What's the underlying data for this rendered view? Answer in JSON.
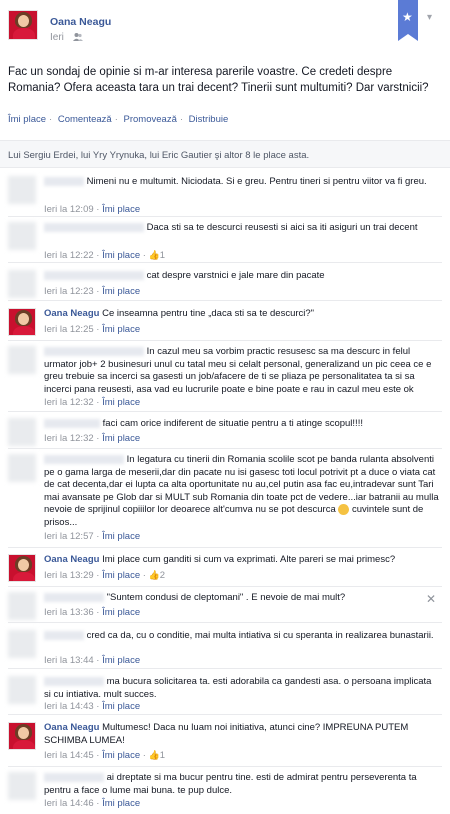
{
  "post": {
    "author": "Oana Neagu",
    "time": "Ieri",
    "text": "Fac un sondaj de opinie si m-ar interesa parerile voastre. Ce credeti despre Romania? Ofera aceasta tara un trai decent? Tinerii sunt multumiti? Dar varstnicii?",
    "actions": [
      "Îmi place",
      "Comentează",
      "Promovează",
      "Distribuie"
    ],
    "likes_text": "Lui Sergiu Erdei, lui Yry Yrynuka, lui Eric Gautier şi altor 8 le place asta."
  },
  "icons": {
    "star": "star-icon",
    "chevron": "chevron-down-icon",
    "people": "people-icon",
    "thumb": "thumbs-up-icon",
    "smiley": "smiley-icon",
    "close": "close-icon"
  },
  "colors": {
    "link": "#3b5998",
    "flag": "#5b7bd5",
    "muted": "#90949c"
  },
  "comments": [
    {
      "text": "Nimeni nu e multumit. Niciodata. Si e greu. Pentru tineri si pentru viitor va fi greu.",
      "time": "Ieri la 12:09",
      "like": "Îmi place",
      "count": ""
    },
    {
      "text": "Daca sti sa te descurci reusesti si aici sa iti asiguri un trai decent",
      "time": "Ieri la 12:22",
      "like": "Îmi place",
      "count": "1"
    },
    {
      "text": "cat despre varstnici e jale mare din pacate",
      "time": "Ieri la 12:23",
      "like": "Îmi place",
      "count": ""
    },
    {
      "author": "Oana Neagu",
      "text": "Ce inseamna pentru tine „daca sti sa te descurci?\"",
      "time": "Ieri la 12:25",
      "like": "Îmi place",
      "count": ""
    },
    {
      "text": "In cazul meu sa vorbim practic resusesc sa ma descurc in felul urmator job+ 2 businesuri unul cu tatal meu si celalt personal, generalizand un pic ceea ce e greu trebuie sa incerci sa gasesti un job/afacere de ti se pliaza pe personalitatea ta si sa incerci pana reusesti, asa vad eu lucrurile poate e bine poate e rau in cazul meu este ok",
      "time": "Ieri la 12:32",
      "like": "Îmi place",
      "count": ""
    },
    {
      "text": "faci cam orice indiferent de situatie pentru a ti atinge scopul!!!!",
      "time": "Ieri la 12:32",
      "like": "Îmi place",
      "count": ""
    },
    {
      "text": "In legatura cu tinerii din Romania scolile scot pe banda rulanta absolventi pe o gama larga de meserii,dar din pacate nu isi gasesc toti locul potrivit pt a duce o viata cat de cat decenta,dar ei lupta ca alta oportunitate nu au,cel putin asa fac eu,intradevar sunt Tari mai avansate pe Glob dar si MULT sub Romania din toate pct de vedere...iar batranii au mulla nevoie de sprijinul copiiilor lor deoarece alt'cumva nu se pot descurca",
      "text_end": "cuvintele sunt de prisos...",
      "time": "Ieri la 12:57",
      "like": "Îmi place",
      "count": ""
    },
    {
      "author": "Oana Neagu",
      "text": "Imi place cum ganditi si cum va exprimati. Alte pareri se mai primesc?",
      "time": "Ieri la 13:29",
      "like": "Îmi place",
      "count": "2"
    },
    {
      "text": "\"Suntem condusi de cleptomani\" . E nevoie de mai mult?",
      "time": "Ieri la 13:36",
      "like": "Îmi place",
      "count": ""
    },
    {
      "text": "cred ca da, cu o conditie, mai multa intiativa si cu speranta in realizarea bunastarii.",
      "time": "Ieri la 13:44",
      "like": "Îmi place",
      "count": ""
    },
    {
      "text": "ma bucura solicitarea ta. esti adorabila ca gandesti asa. o persoana implicata si cu intiativa. mult succes.",
      "time": "Ieri la 14:43",
      "like": "Îmi place",
      "count": ""
    },
    {
      "author": "Oana Neagu",
      "text": "Multumesc! Daca nu luam noi initiativa, atunci cine? IMPREUNA PUTEM SCHIMBA LUMEA!",
      "time": "Ieri la 14:45",
      "like": "Îmi place",
      "count": "1"
    },
    {
      "text": "ai dreptate si ma bucur pentru tine. esti de admirat pentru perseverenta ta pentru a face o lume mai buna. te pup dulce.",
      "time": "Ieri la 14:46",
      "like": "Îmi place",
      "count": ""
    }
  ]
}
